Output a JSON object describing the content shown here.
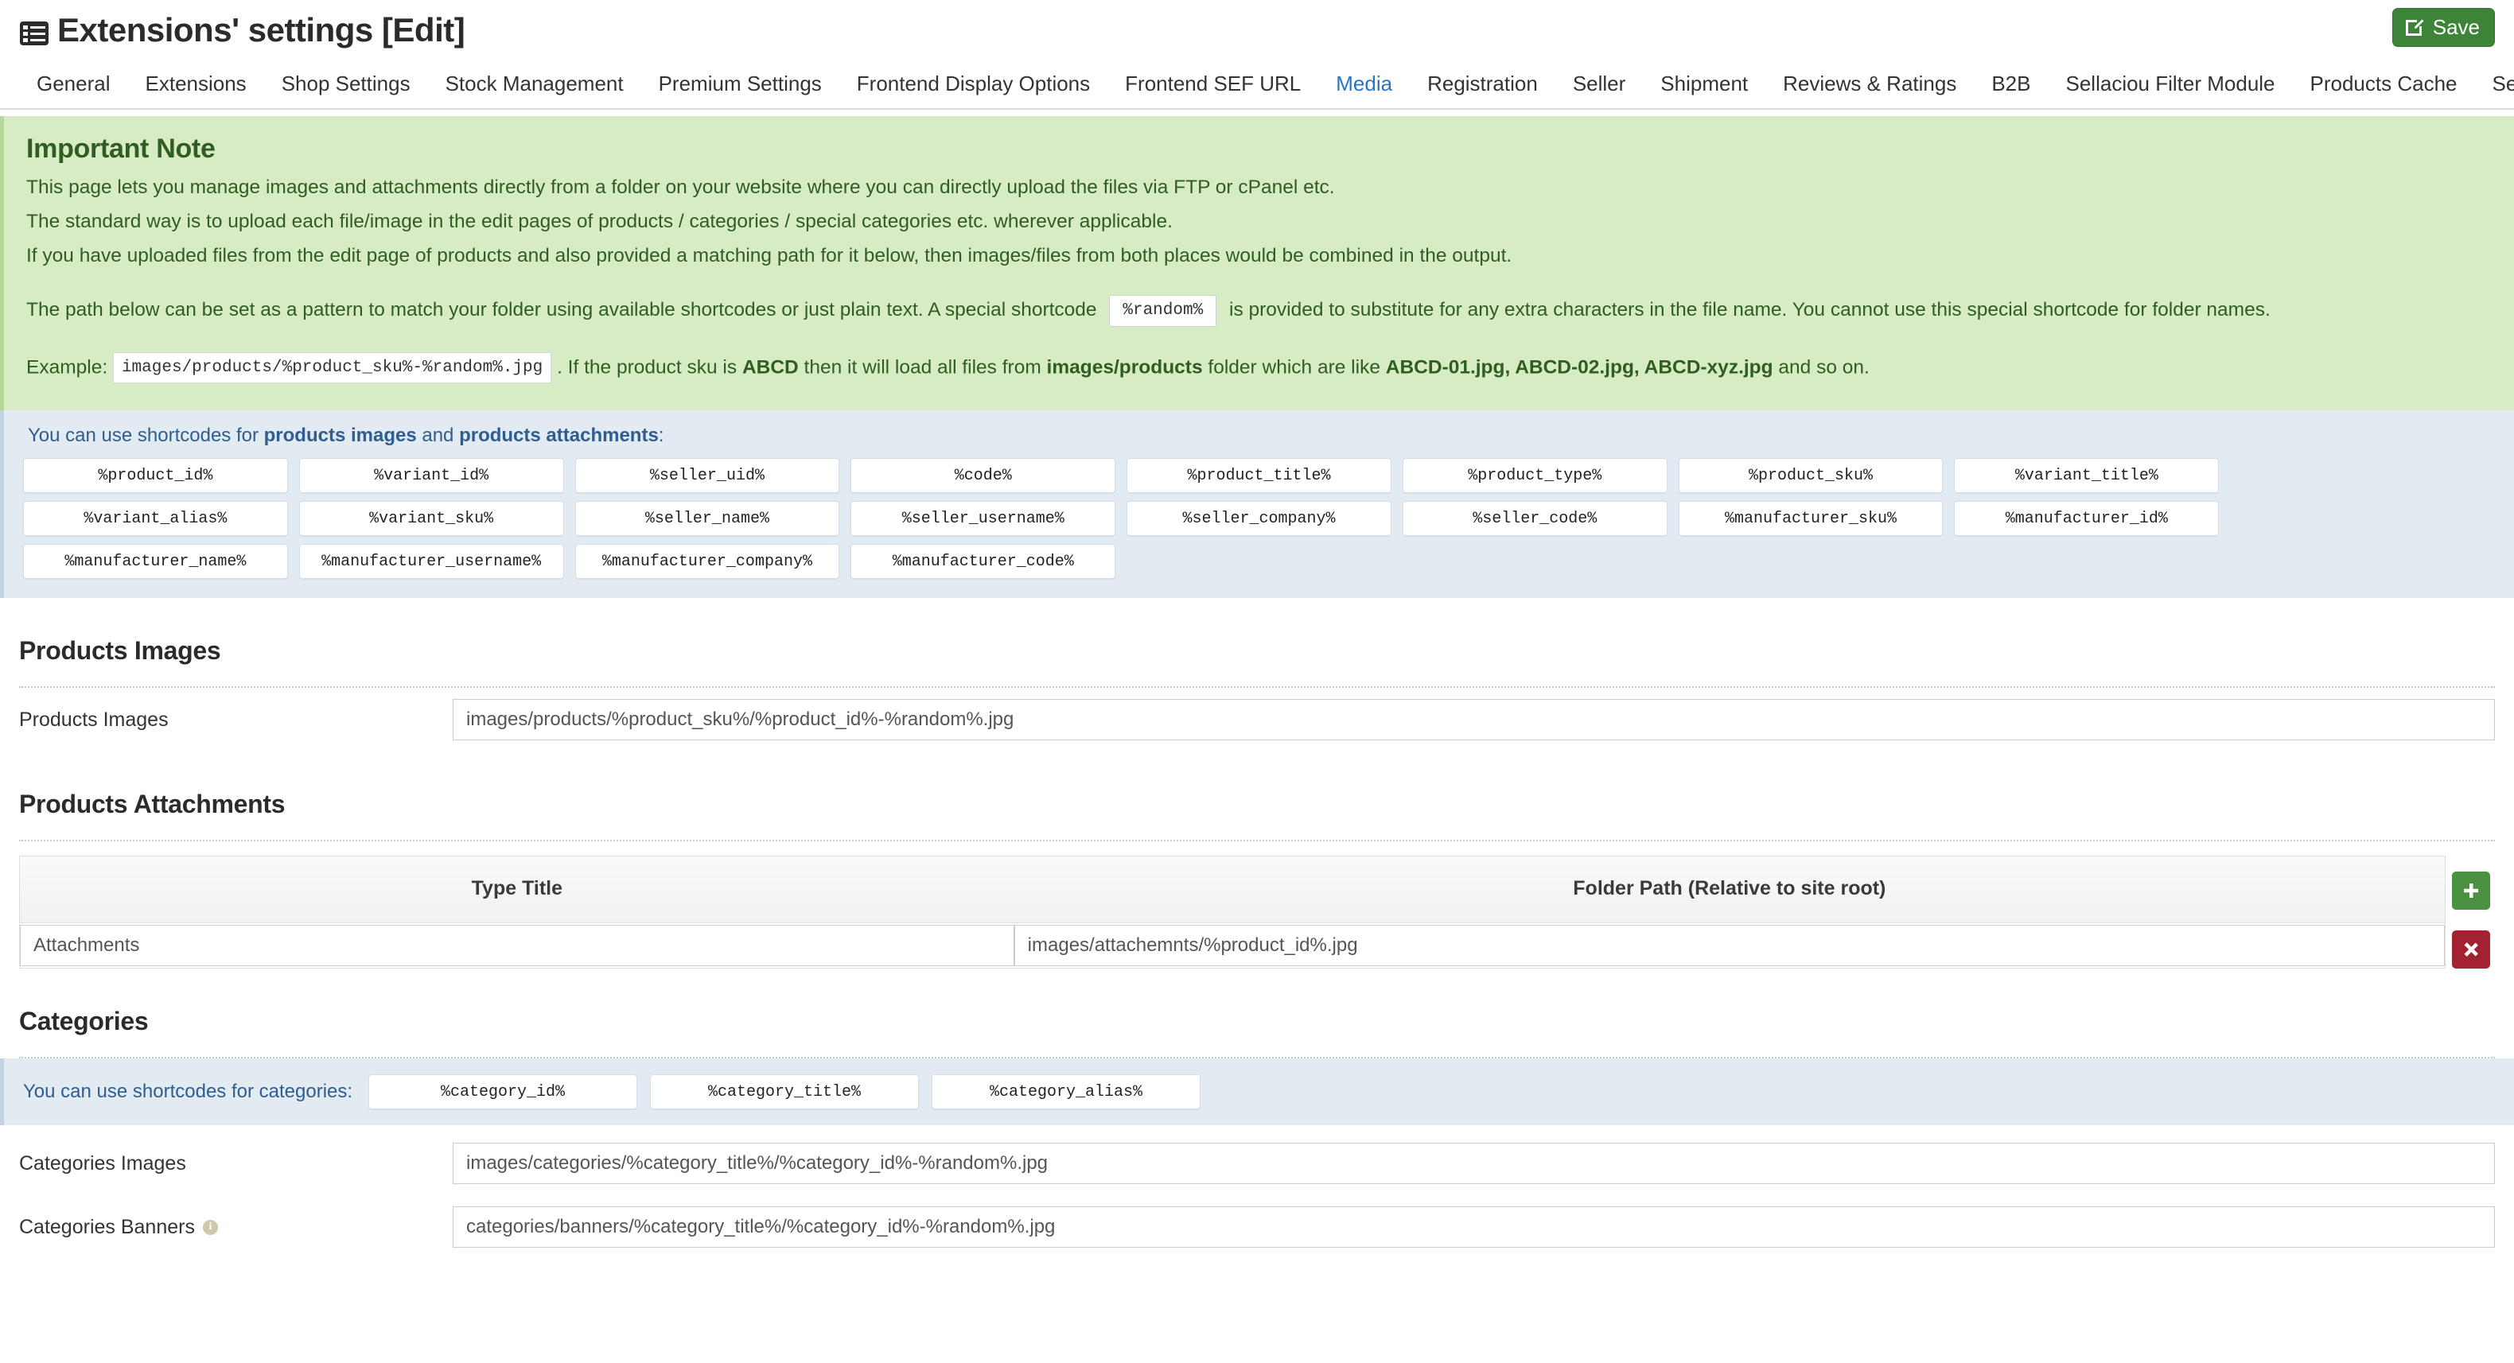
{
  "header": {
    "title": "Extensions' settings [Edit]",
    "title_icon": "list-settings-icon",
    "save_label": "Save",
    "save_icon": "edit-pencil-icon",
    "save_color": "#3e8438"
  },
  "tabs": {
    "active": "Media",
    "active_color": "#2b74c4",
    "items": [
      "General",
      "Extensions",
      "Shop Settings",
      "Stock Management",
      "Premium Settings",
      "Frontend Display Options",
      "Frontend SEF URL",
      "Media",
      "Registration",
      "Seller",
      "Shipment",
      "Reviews & Ratings",
      "B2B",
      "Sellaciou Filter Module",
      "Products Cache",
      "Sellacious Mailer"
    ]
  },
  "notice": {
    "background": "#d7ecc4",
    "text_color": "#2f5d22",
    "heading": "Important Note",
    "line1": "This page lets you manage images and attachments directly from a folder on your website where you can directly upload the files via FTP or cPanel etc.",
    "line2": "The standard way is to upload each file/image in the edit pages of products / categories / special categories etc. wherever applicable.",
    "line3": "If you have uploaded files from the edit page of products and also provided a matching path for it below, then images/files from both places would be combined in the output.",
    "pattern_pre": "The path below can be set as a pattern to match your folder using available shortcodes or just plain text. A special shortcode",
    "pattern_chip": "%random%",
    "pattern_post": "is provided to substitute for any extra characters in the file name. You cannot use this special shortcode for folder names.",
    "example_label": "Example:",
    "example_code": "images/products/%product_sku%-%random%.jpg",
    "example_mid_a": ". If the product sku is",
    "example_sku": "ABCD",
    "example_mid_b": "then it will load all files from",
    "example_folder": "images/products",
    "example_mid_c": "folder which are like",
    "example_files": "ABCD-01.jpg, ABCD-02.jpg, ABCD-xyz.jpg",
    "example_end": "and so on."
  },
  "shortcodes_products": {
    "background": "#e2eaf2",
    "label_color": "#2f5d8f",
    "intro_pre": "You can use shortcodes for ",
    "intro_bold_a": "products images",
    "intro_mid": " and ",
    "intro_bold_b": "products attachments",
    "intro_post": ":",
    "chips": [
      "%product_id%",
      "%variant_id%",
      "%seller_uid%",
      "%code%",
      "%product_title%",
      "%product_type%",
      "%product_sku%",
      "%variant_title%",
      "%variant_alias%",
      "%variant_sku%",
      "%seller_name%",
      "%seller_username%",
      "%seller_company%",
      "%seller_code%",
      "%manufacturer_sku%",
      "%manufacturer_id%",
      "%manufacturer_name%",
      "%manufacturer_username%",
      "%manufacturer_company%",
      "%manufacturer_code%"
    ]
  },
  "products_images": {
    "heading": "Products Images",
    "field_label": "Products Images",
    "field_value": "images/products/%product_sku%/%product_id%-%random%.jpg"
  },
  "products_attachments": {
    "heading": "Products Attachments",
    "columns": [
      "Type Title",
      "Folder Path (Relative to site root)"
    ],
    "rows": [
      {
        "type_title": "Attachments",
        "folder_path": "images/attachemnts/%product_id%.jpg"
      }
    ],
    "add_label": "+",
    "add_icon": "plus-icon",
    "add_color": "#4a9141",
    "delete_label": "✕",
    "delete_icon": "cross-icon",
    "delete_color": "#a32231"
  },
  "categories": {
    "heading": "Categories",
    "shortcodes_label": "You can use shortcodes for categories:",
    "shortcodes": [
      "%category_id%",
      "%category_title%",
      "%category_alias%"
    ],
    "fields": [
      {
        "label": "Categories Images",
        "value": "images/categories/%category_title%/%category_id%-%random%.jpg",
        "info": false
      },
      {
        "label": "Categories Banners",
        "value": "categories/banners/%category_title%/%category_id%-%random%.jpg",
        "info": true,
        "info_icon": "info-icon"
      }
    ]
  }
}
